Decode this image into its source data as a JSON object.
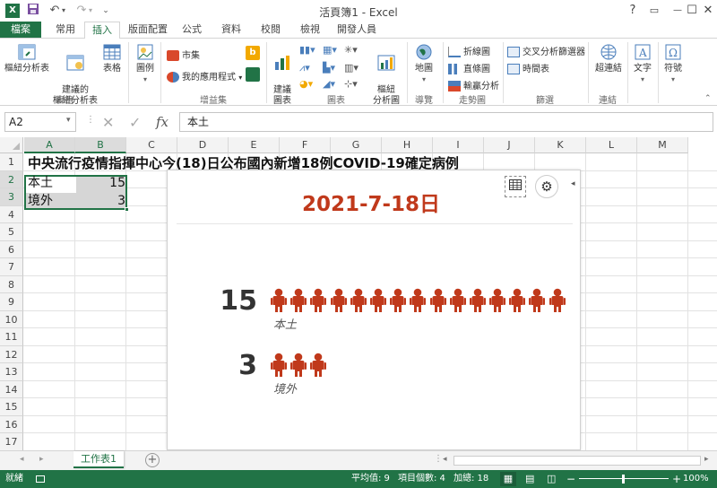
{
  "window": {
    "title": "活頁簿1 - Excel",
    "help": "?",
    "minimize": "—",
    "restore": "☐",
    "close": "✕"
  },
  "ribbon_tabs": [
    "常用",
    "插入",
    "版面配置",
    "公式",
    "資料",
    "校閱",
    "檢視",
    "開發人員"
  ],
  "file_tab": "檔案",
  "ribbon": {
    "tables_group": "表格",
    "pivot_table": "樞紐分析表",
    "recommended_pivot": "建議的\n樞紐分析表",
    "table": "表格",
    "illustrations": "圖例",
    "addins_group": "增益集",
    "store": "市集",
    "my_apps": "我的應用程式",
    "charts_group": "圖表",
    "recommended_charts": "建議\n圖表",
    "pivot_chart": "樞紐\n分析圖",
    "tours_group": "導覽",
    "map": "地圖",
    "sparklines_group": "走勢圖",
    "spark_line": "折線圖",
    "spark_column": "直條圖",
    "spark_winloss": "輸贏分析",
    "filters_group": "篩選",
    "slicer": "交叉分析篩選器",
    "timeline": "時間表",
    "links_group": "連結",
    "hyperlink": "超連結",
    "text": "文字",
    "symbols": "符號"
  },
  "formula_bar": {
    "name_box": "A2",
    "fx": "fx",
    "content": "本土"
  },
  "columns": [
    "A",
    "B",
    "C",
    "D",
    "E",
    "F",
    "G",
    "H",
    "I",
    "J",
    "K",
    "L",
    "M"
  ],
  "rows": [
    "1",
    "2",
    "3",
    "4",
    "5",
    "6",
    "7",
    "8",
    "9",
    "10",
    "11",
    "12",
    "13",
    "14",
    "15",
    "16",
    "17"
  ],
  "cells": {
    "A1": "中央流行疫情指揮中心今(18)日公布國內新增18例COVID-19確定病例",
    "A2": "本土",
    "B2": "15",
    "A3": "境外",
    "B3": "3"
  },
  "panel": {
    "title": "2021-7-18日",
    "accent": "#c0391b",
    "items": [
      {
        "value": "15",
        "label": "本土",
        "count": 15
      },
      {
        "value": "3",
        "label": "境外",
        "count": 3
      }
    ]
  },
  "sheet_tab": "工作表1",
  "status": {
    "ready": "就緒",
    "average": "平均值: 9",
    "count": "項目個數: 4",
    "sum": "加總: 18",
    "zoom": "100%"
  }
}
